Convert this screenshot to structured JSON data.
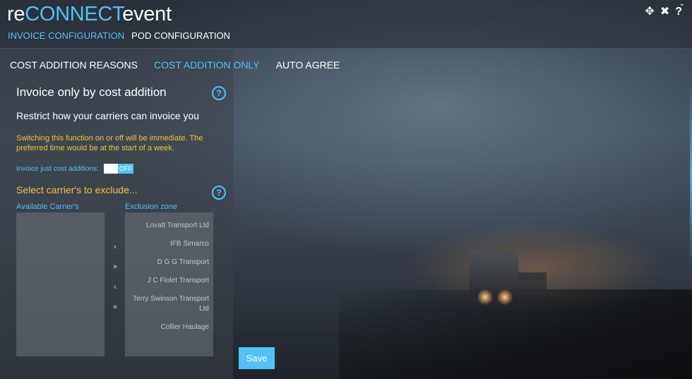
{
  "app": {
    "title_prefix": "re",
    "title_accent": "CONNECT",
    "title_suffix": "event"
  },
  "top_nav": [
    {
      "label": "INVOICE CONFIGURATION",
      "active": true
    },
    {
      "label": "POD CONFIGURATION",
      "active": false
    }
  ],
  "window_controls": {
    "move_icon": "move-icon",
    "close_icon": "close-icon",
    "help_icon": "help-icon",
    "move_glyph": "✥",
    "close_glyph": "✖",
    "help_glyph": "?",
    "chevron_glyph": "⌄"
  },
  "sub_tabs": [
    {
      "label": "COST ADDITION REASONS",
      "active": false
    },
    {
      "label": "COST ADDITION ONLY",
      "active": true
    },
    {
      "label": "AUTO AGREE",
      "active": false
    }
  ],
  "main": {
    "section_title": "Invoice only by cost addition",
    "restrict_text": "Restrict how your carriers can invoice you",
    "warning_text": "Switching this function on or off will be immediate. The preferred time would be at the start of a week.",
    "toggle_label": "Invoice just cost additions:",
    "toggle_state": "OFF",
    "exclude_title": "Select carrier's to exclude...",
    "help_glyph": "?"
  },
  "lists": {
    "available_header": "Available Carrier's",
    "exclusion_header": "Exclusion zone",
    "available_items": [],
    "exclusion_items": [
      "Lovatt Transport Ltd",
      "IFB Simarco",
      "D G G Transport",
      "J C Fiolet Transport",
      "Terry Swinson Transport Ltd",
      "Collier Haulage"
    ]
  },
  "move_buttons": [
    {
      "glyph": "›",
      "name": "move-right-button"
    },
    {
      "glyph": "»",
      "name": "move-all-right-button"
    },
    {
      "glyph": "‹",
      "name": "move-left-button"
    },
    {
      "glyph": "«",
      "name": "move-all-left-button"
    }
  ],
  "save_label": "Save",
  "colors": {
    "accent": "#4fc3f7",
    "warning": "#f0c53a",
    "text": "#ffffff"
  }
}
